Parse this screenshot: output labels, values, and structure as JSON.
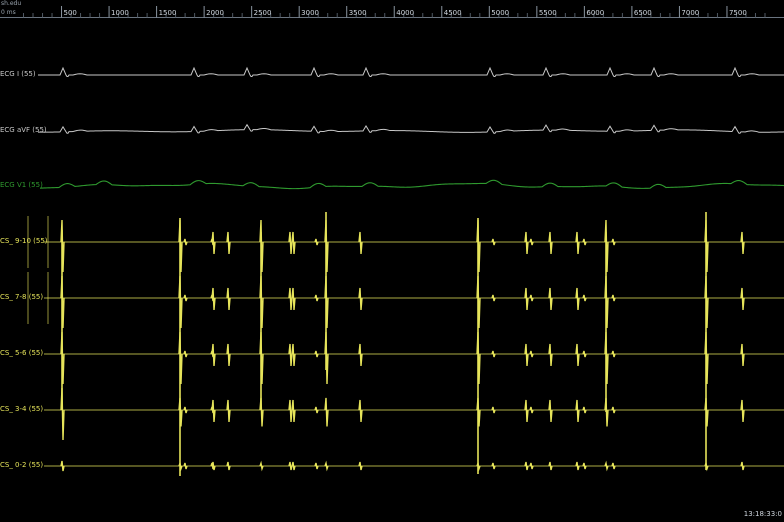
{
  "header": {
    "corner_top": "sh.edu",
    "corner_unit": "0 ms"
  },
  "time_axis": {
    "tick_labels": [
      "500",
      "1000",
      "1500",
      "2000",
      "2500",
      "3000",
      "3500",
      "4000",
      "4500",
      "5000",
      "5500",
      "6000",
      "6500",
      "7000",
      "7500"
    ],
    "tick_ms": [
      500,
      1000,
      1500,
      2000,
      2500,
      3000,
      3500,
      4000,
      4500,
      5000,
      5500,
      6000,
      6500,
      7000,
      7500
    ],
    "range_ms": [
      0,
      8100
    ]
  },
  "channels": [
    {
      "name": "ECG I (55)",
      "color": "#c8c8c8",
      "type": "ecg"
    },
    {
      "name": "ECG aVF (55)",
      "color": "#c8c8c8",
      "type": "ecg_wavy"
    },
    {
      "name": "ECG V1 (55)",
      "color": "#2f9a2f",
      "type": "ecg_wide"
    },
    {
      "name": "CS_ 9-10 (55)",
      "color": "#e6e45a",
      "type": "cs"
    },
    {
      "name": "CS_ 7-8 (55)",
      "color": "#e6e45a",
      "type": "cs"
    },
    {
      "name": "CS_ 5-6 (55)",
      "color": "#e6e45a",
      "type": "cs"
    },
    {
      "name": "CS_ 3-4 (55)",
      "color": "#e6e45a",
      "type": "cs"
    },
    {
      "name": "CS_ 0-2 (55)",
      "color": "#e6e45a",
      "type": "cs"
    }
  ],
  "status": {
    "timestamp": "13:18:33:0"
  }
}
